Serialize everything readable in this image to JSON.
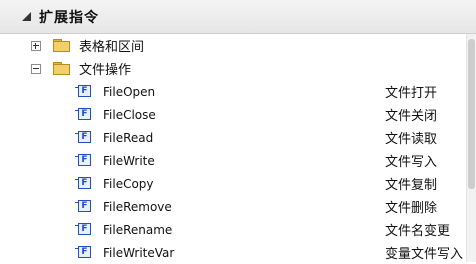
{
  "panel": {
    "title": "扩展指令"
  },
  "groups": [
    {
      "label": "表格和区间",
      "expanded": false
    },
    {
      "label": "文件操作",
      "expanded": true
    }
  ],
  "items": [
    {
      "name": "FileOpen",
      "desc": "文件打开"
    },
    {
      "name": "FileClose",
      "desc": "文件关闭"
    },
    {
      "name": "FileRead",
      "desc": "文件读取"
    },
    {
      "name": "FileWrite",
      "desc": "文件写入"
    },
    {
      "name": "FileCopy",
      "desc": "文件复制"
    },
    {
      "name": "FileRemove",
      "desc": "文件删除"
    },
    {
      "name": "FileRename",
      "desc": "文件名变更"
    },
    {
      "name": "FileWriteVar",
      "desc": "变量文件写入"
    }
  ],
  "icons": {
    "function": "F",
    "function_icon_color": "#1f4ec9",
    "folder_color": "#f3cf6a"
  }
}
